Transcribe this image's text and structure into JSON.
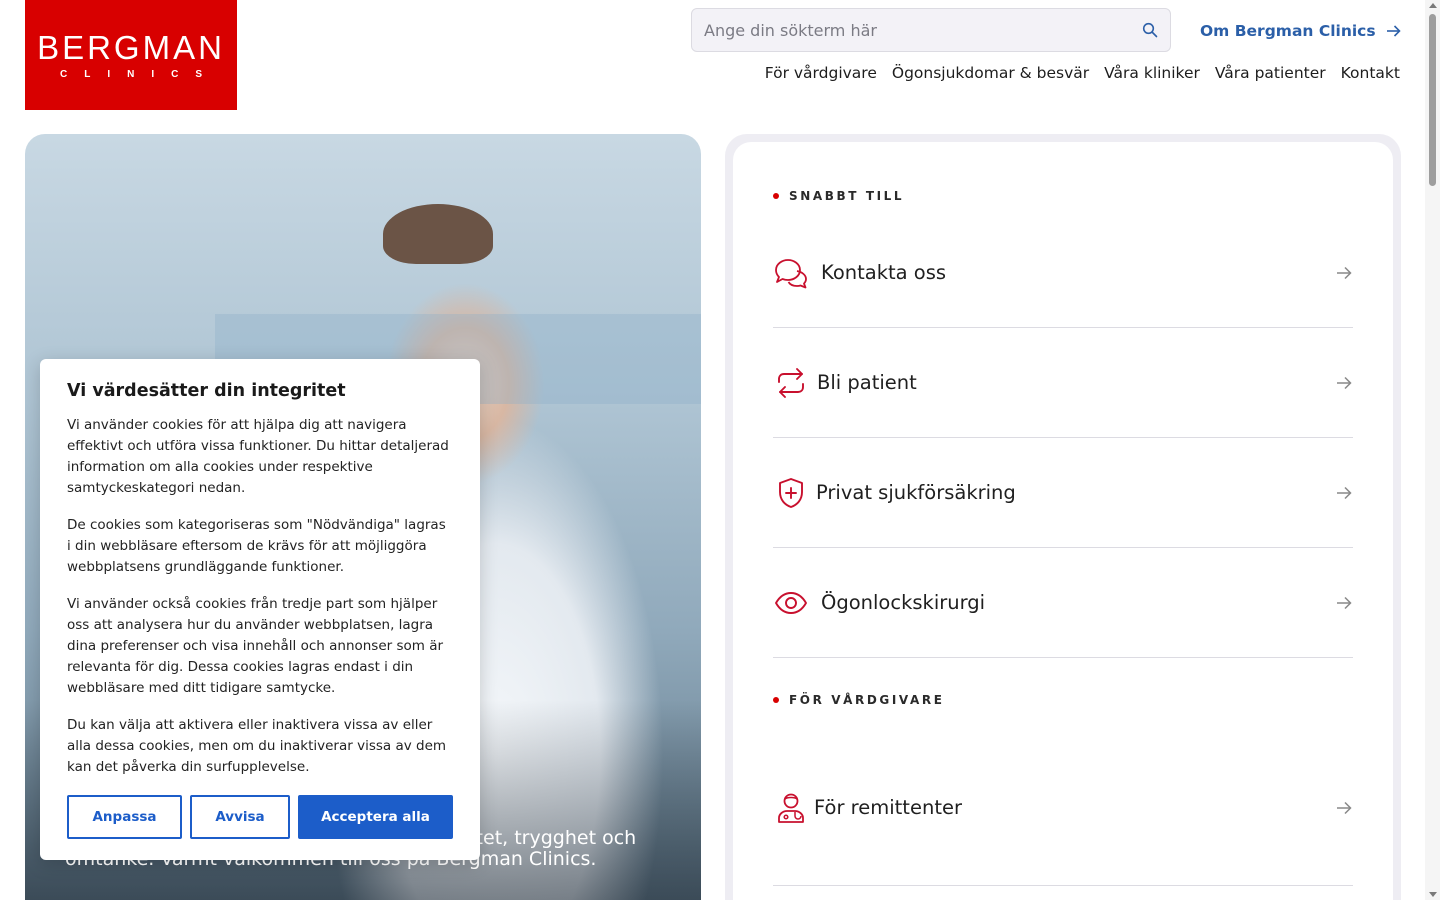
{
  "brand": {
    "name": "BERGMAN",
    "sub": "CLINICS",
    "color": "#d80000"
  },
  "search": {
    "placeholder": "Ange din sökterm här"
  },
  "header": {
    "about_link": "Om Bergman Clinics"
  },
  "nav": [
    "För vårdgivare",
    "Ögonsjukdomar & besvär",
    "Våra kliniker",
    "Våra patienter",
    "Kontakt"
  ],
  "hero": {
    "caption_line1": "litet, trygghet och",
    "caption_line2": "omtanke. Varmt välkommen till oss på Bergman Clinics."
  },
  "cookie": {
    "title": "Vi värdesätter din integritet",
    "paragraphs": [
      "Vi använder cookies för att hjälpa dig att navigera effektivt och utföra vissa funktioner. Du hittar detaljerad information om alla cookies under respektive samtyckeskategori nedan.",
      "De cookies som kategoriseras som \"Nödvändiga\" lagras i din webbläsare eftersom de krävs för att möjliggöra webbplatsens grundläggande funktioner.",
      "Vi använder också cookies från tredje part som hjälper oss att analysera hur du använder webbplatsen, lagra dina preferenser och visa innehåll och annonser som är relevanta för dig. Dessa cookies lagras endast i din webbläsare med ditt tidigare samtycke.",
      "Du kan välja att aktivera eller inaktivera vissa av eller alla dessa cookies, men om du inaktiverar vissa av dem kan det påverka din surfupplevelse."
    ],
    "buttons": {
      "customize": "Anpassa",
      "reject": "Avvisa",
      "accept": "Acceptera alla"
    },
    "accent_color": "#1c5dc9"
  },
  "quick": {
    "label": "SNABBT TILL",
    "items": [
      {
        "label": "Kontakta oss",
        "icon": "chat-bubbles-icon"
      },
      {
        "label": "Bli patient",
        "icon": "repeat-arrows-icon"
      },
      {
        "label": "Privat sjukförsäkring",
        "icon": "shield-plus-icon"
      },
      {
        "label": "Ögonlockskirurgi",
        "icon": "eye-icon"
      }
    ]
  },
  "providers": {
    "label": "FÖR VÅRDGIVARE",
    "items": [
      {
        "label": "För remittenter",
        "icon": "doctor-icon"
      }
    ]
  }
}
